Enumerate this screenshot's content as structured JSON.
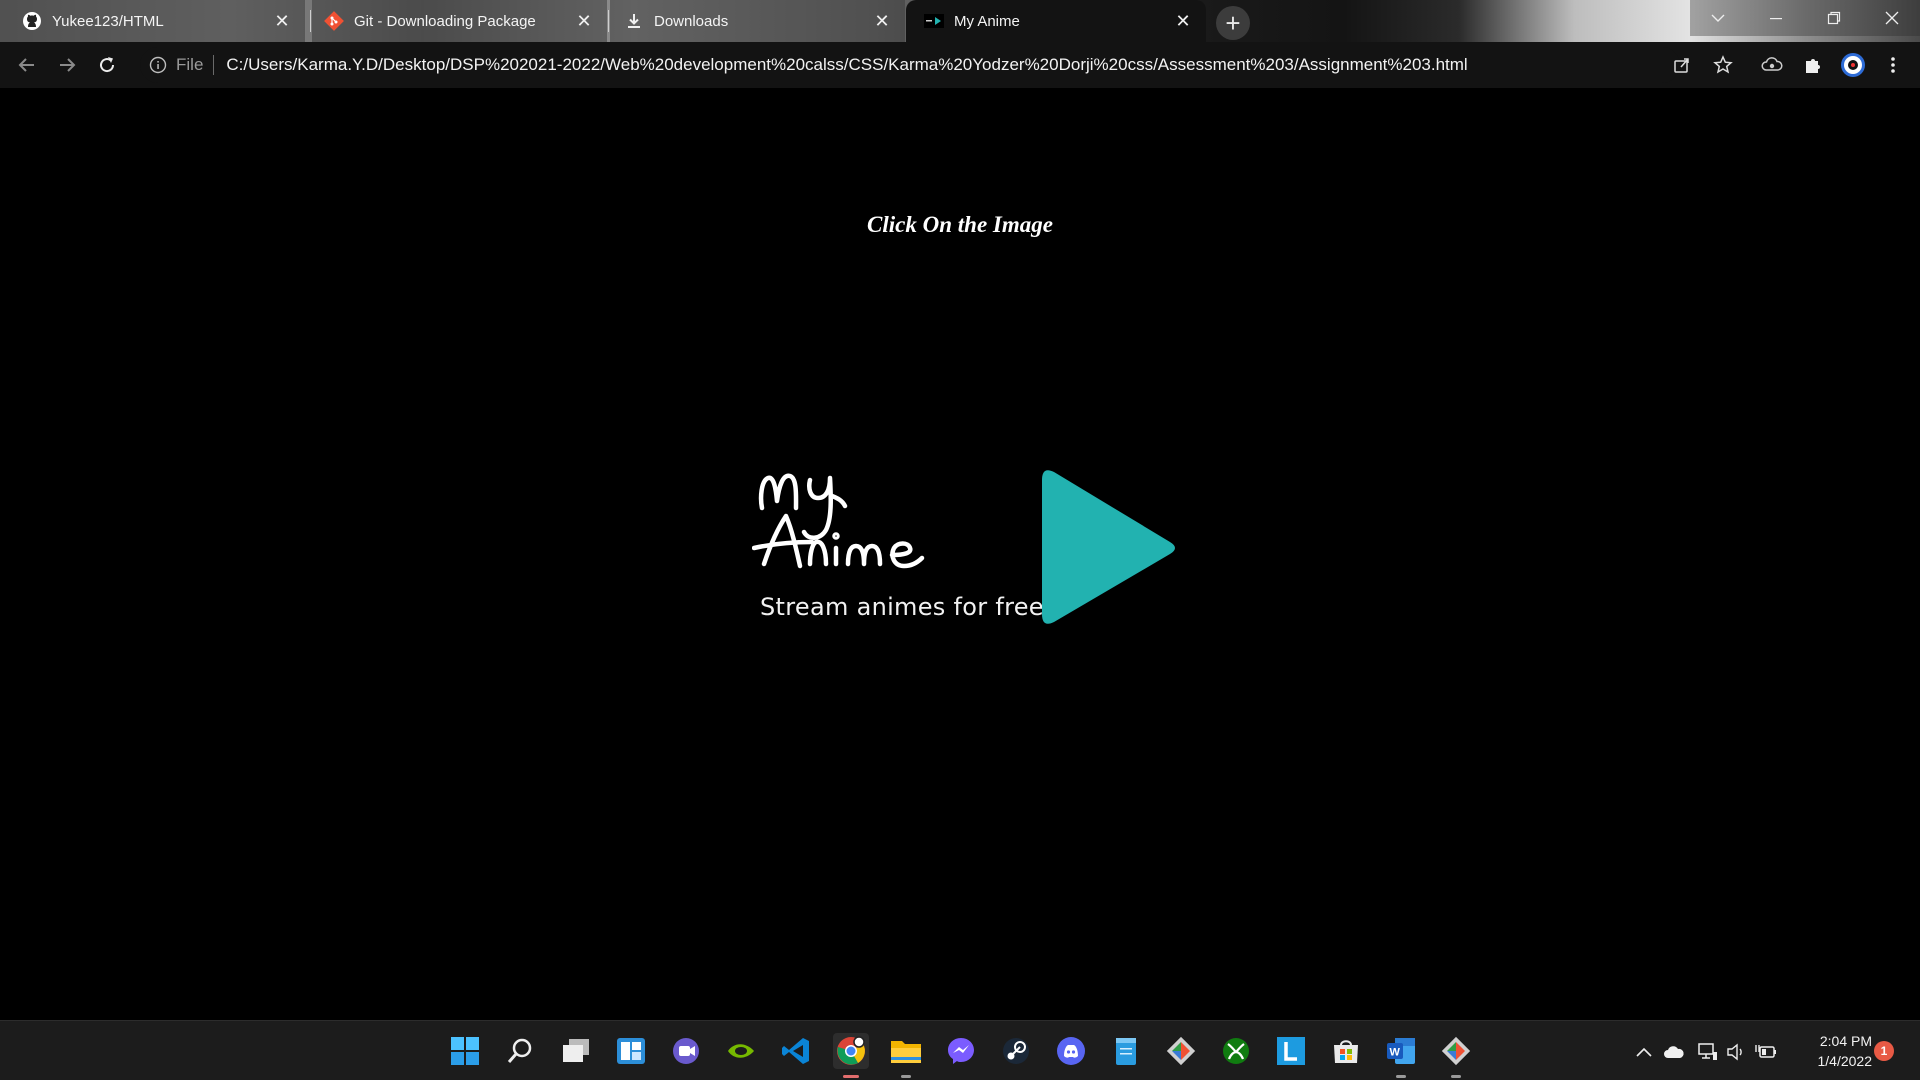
{
  "browser": {
    "tabs": [
      {
        "title": "Yukee123/HTML",
        "favicon": "github-icon"
      },
      {
        "title": "Git - Downloading Package",
        "favicon": "git-icon"
      },
      {
        "title": "Downloads",
        "favicon": "download-icon"
      },
      {
        "title": "My Anime",
        "favicon": "page-favicon-icon",
        "active": true
      }
    ],
    "new_tab_label": "+",
    "address_bar": {
      "scheme_label": "File",
      "url": "C:/Users/Karma.Y.D/Desktop/DSP%202021-2022/Web%20development%20calss/CSS/Karma%20Yodzer%20Dorji%20css/Assessment%203/Assignment%203.html"
    },
    "toolbar_icons": [
      "back-icon",
      "forward-icon",
      "reload-icon",
      "info-icon",
      "share-icon",
      "star-icon",
      "extension-cloud-icon",
      "puzzle-icon",
      "profile-icon",
      "menu-icon"
    ]
  },
  "page": {
    "heading": "Click On the Image",
    "logo": {
      "tagline": "Stream animes for free",
      "title_lettering": "My Anime",
      "play_color": "#22b2b0"
    }
  },
  "taskbar": {
    "apps": [
      "windows-start-icon",
      "search-icon",
      "task-view-icon",
      "widgets-icon",
      "teams-chat-icon",
      "nvidia-icon",
      "vscode-icon",
      "chrome-icon",
      "file-explorer-icon",
      "messenger-icon",
      "steam-icon",
      "discord-icon",
      "notepad-icon",
      "git-icon",
      "xbox-icon",
      "l-app-icon",
      "store-icon",
      "word-icon",
      "git-gui-icon"
    ],
    "tray_icons": [
      "chevron-up-icon",
      "onedrive-cloud-icon",
      "network-icon",
      "speaker-icon",
      "battery-icon"
    ],
    "time": "2:04 PM",
    "date": "1/4/2022",
    "notification_count": "1"
  },
  "colors": {
    "page_background": "#000000",
    "accent_play": "#22b2b0",
    "tab_active": "#131313",
    "taskbar": "#1c1c1c",
    "notification_badge": "#e85a45"
  }
}
